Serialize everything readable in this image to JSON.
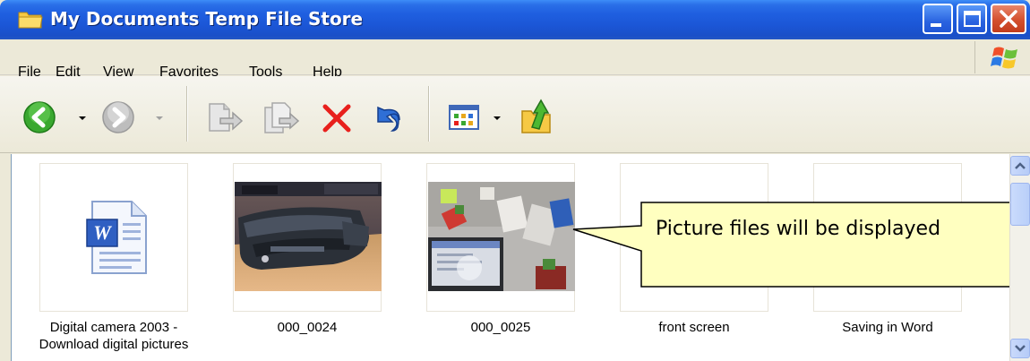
{
  "window": {
    "title": "My Documents Temp File Store"
  },
  "menu": {
    "items": [
      {
        "label": "File",
        "access": "F"
      },
      {
        "label": "Edit",
        "access": "E"
      },
      {
        "label": "View",
        "access": "V"
      },
      {
        "label": "Favorites",
        "access": "a"
      },
      {
        "label": "Tools",
        "access": "T"
      },
      {
        "label": "Help",
        "access": "H"
      }
    ]
  },
  "toolbar": {
    "buttons": [
      "back-icon",
      "forward-icon",
      "move-to-icon",
      "copy-to-icon",
      "delete-icon",
      "undo-icon",
      "views-icon",
      "folder-up-icon"
    ]
  },
  "files": [
    {
      "name_line1": "Digital camera 2003 -",
      "name_line2": "Download digital pictures",
      "kind": "word-document"
    },
    {
      "name_line1": "000_0024",
      "name_line2": "",
      "kind": "photo"
    },
    {
      "name_line1": "000_0025",
      "name_line2": "",
      "kind": "photo"
    },
    {
      "name_line1": "front screen",
      "name_line2": "",
      "kind": "blank"
    },
    {
      "name_line1": "Saving in Word",
      "name_line2": "",
      "kind": "blank"
    }
  ],
  "callout": {
    "text": "Picture files will be displayed"
  },
  "colors": {
    "titlebar": "#1f5fe0",
    "callout_fill": "#ffffc0",
    "delete_red": "#e8201c"
  }
}
